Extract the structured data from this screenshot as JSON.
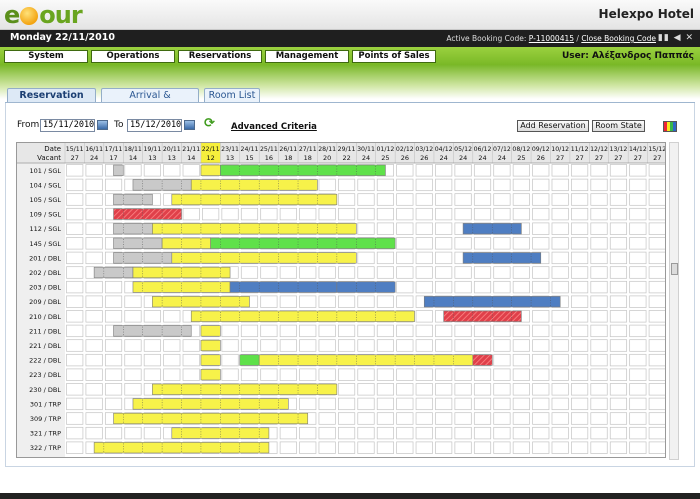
{
  "header": {
    "logo": "etour",
    "hotel": "Helexpo Hotel"
  },
  "topbar": {
    "date": "Monday 22/11/2010",
    "booking_code_label": "Active Booking Code:",
    "booking_code": "P-11000415",
    "close_label": "Close Booking Code"
  },
  "menu": {
    "items": [
      "System",
      "Operations",
      "Reservations",
      "Management",
      "Points of Sales"
    ],
    "user_label": "User:",
    "user_name": "Αλέξανδρος Παππάς"
  },
  "tabs": [
    {
      "label": "Reservation Plan",
      "active": true
    },
    {
      "label": "Arrival & Departures",
      "active": false
    },
    {
      "label": "Room List",
      "active": false
    }
  ],
  "filters": {
    "from_label": "From",
    "from_value": "15/11/2010",
    "to_label": "To",
    "to_value": "15/12/2010",
    "advanced_label": "Advanced Criteria"
  },
  "actions": {
    "add": "Add Reservation",
    "state": "Room State"
  },
  "plan": {
    "corner": [
      "Date",
      "Vacant"
    ],
    "today_index": 7,
    "days": [
      {
        "d": "15/11",
        "v": "27"
      },
      {
        "d": "16/11",
        "v": "24"
      },
      {
        "d": "17/11",
        "v": "17"
      },
      {
        "d": "18/11",
        "v": "14"
      },
      {
        "d": "19/11",
        "v": "13"
      },
      {
        "d": "20/11",
        "v": "13"
      },
      {
        "d": "21/11",
        "v": "14"
      },
      {
        "d": "22/11",
        "v": "12"
      },
      {
        "d": "23/11",
        "v": "13"
      },
      {
        "d": "24/11",
        "v": "15"
      },
      {
        "d": "25/11",
        "v": "16"
      },
      {
        "d": "26/11",
        "v": "18"
      },
      {
        "d": "27/11",
        "v": "18"
      },
      {
        "d": "28/11",
        "v": "20"
      },
      {
        "d": "29/11",
        "v": "22"
      },
      {
        "d": "30/11",
        "v": "24"
      },
      {
        "d": "01/12",
        "v": "25"
      },
      {
        "d": "02/12",
        "v": "26"
      },
      {
        "d": "03/12",
        "v": "26"
      },
      {
        "d": "04/12",
        "v": "24"
      },
      {
        "d": "05/12",
        "v": "24"
      },
      {
        "d": "06/12",
        "v": "24"
      },
      {
        "d": "07/12",
        "v": "24"
      },
      {
        "d": "08/12",
        "v": "25"
      },
      {
        "d": "09/12",
        "v": "26"
      },
      {
        "d": "10/12",
        "v": "27"
      },
      {
        "d": "11/12",
        "v": "27"
      },
      {
        "d": "12/12",
        "v": "27"
      },
      {
        "d": "13/12",
        "v": "27"
      },
      {
        "d": "14/12",
        "v": "27"
      },
      {
        "d": "15/12",
        "v": "27"
      }
    ],
    "rooms": [
      "101 / SGL",
      "104 / SGL",
      "105 / SGL",
      "109 / SGL",
      "112 / SGL",
      "145 / SGL",
      "201 / DBL",
      "202 / DBL",
      "203 / DBL",
      "209 / DBL",
      "210 / DBL",
      "211 / DBL",
      "221 / DBL",
      "222 / DBL",
      "223 / DBL",
      "230 / DBL",
      "301 / TRP",
      "309 / TRP",
      "321 / TRP",
      "322 / TRP"
    ],
    "colors": {
      "yellow": "#f7f24a",
      "green": "#5fe14a",
      "gray": "#c9c9c9",
      "blue": "#4f7ec2",
      "red": "#e0404a"
    },
    "bookings": [
      {
        "row": 0,
        "start": 2.5,
        "end": 3,
        "c": "gray"
      },
      {
        "row": 0,
        "start": 7,
        "end": 8,
        "c": "yellow"
      },
      {
        "row": 0,
        "start": 8,
        "end": 16.5,
        "c": "green"
      },
      {
        "row": 1,
        "start": 3.5,
        "end": 6.5,
        "c": "gray"
      },
      {
        "row": 1,
        "start": 6.5,
        "end": 13,
        "c": "yellow"
      },
      {
        "row": 2,
        "start": 2.5,
        "end": 4.5,
        "c": "gray"
      },
      {
        "row": 2,
        "start": 5.5,
        "end": 14,
        "c": "yellow"
      },
      {
        "row": 3,
        "start": 2.5,
        "end": 6,
        "c": "red"
      },
      {
        "row": 4,
        "start": 2.5,
        "end": 4.5,
        "c": "gray"
      },
      {
        "row": 4,
        "start": 4.5,
        "end": 15,
        "c": "yellow"
      },
      {
        "row": 4,
        "start": 20.5,
        "end": 23.5,
        "c": "blue"
      },
      {
        "row": 5,
        "start": 2.5,
        "end": 5,
        "c": "gray"
      },
      {
        "row": 5,
        "start": 5,
        "end": 7.5,
        "c": "yellow"
      },
      {
        "row": 5,
        "start": 7.5,
        "end": 17,
        "c": "green"
      },
      {
        "row": 6,
        "start": 2.5,
        "end": 5.5,
        "c": "gray"
      },
      {
        "row": 6,
        "start": 5.5,
        "end": 15,
        "c": "yellow"
      },
      {
        "row": 6,
        "start": 20.5,
        "end": 24.5,
        "c": "blue"
      },
      {
        "row": 7,
        "start": 1.5,
        "end": 3.5,
        "c": "gray"
      },
      {
        "row": 7,
        "start": 3.5,
        "end": 8.5,
        "c": "yellow"
      },
      {
        "row": 8,
        "start": 3.5,
        "end": 8.5,
        "c": "yellow"
      },
      {
        "row": 8,
        "start": 8.5,
        "end": 14,
        "c": "blue"
      },
      {
        "row": 8,
        "start": 14,
        "end": 17,
        "c": "blue"
      },
      {
        "row": 9,
        "start": 4.5,
        "end": 9.5,
        "c": "yellow"
      },
      {
        "row": 9,
        "start": 18.5,
        "end": 25.5,
        "c": "blue"
      },
      {
        "row": 10,
        "start": 6.5,
        "end": 18,
        "c": "yellow"
      },
      {
        "row": 10,
        "start": 19.5,
        "end": 23.5,
        "c": "red"
      },
      {
        "row": 11,
        "start": 2.5,
        "end": 6.5,
        "c": "gray"
      },
      {
        "row": 11,
        "start": 7,
        "end": 8,
        "c": "yellow"
      },
      {
        "row": 12,
        "start": 7,
        "end": 8,
        "c": "yellow"
      },
      {
        "row": 13,
        "start": 7,
        "end": 8,
        "c": "yellow"
      },
      {
        "row": 13,
        "start": 9,
        "end": 10,
        "c": "green"
      },
      {
        "row": 13,
        "start": 10,
        "end": 21,
        "c": "yellow"
      },
      {
        "row": 13,
        "start": 21,
        "end": 22,
        "c": "red"
      },
      {
        "row": 14,
        "start": 7,
        "end": 8,
        "c": "yellow"
      },
      {
        "row": 15,
        "start": 4.5,
        "end": 14,
        "c": "yellow"
      },
      {
        "row": 16,
        "start": 3.5,
        "end": 11.5,
        "c": "yellow"
      },
      {
        "row": 17,
        "start": 2.5,
        "end": 12.5,
        "c": "yellow"
      },
      {
        "row": 18,
        "start": 5.5,
        "end": 10.5,
        "c": "yellow"
      },
      {
        "row": 19,
        "start": 1.5,
        "end": 10.5,
        "c": "yellow"
      }
    ]
  }
}
